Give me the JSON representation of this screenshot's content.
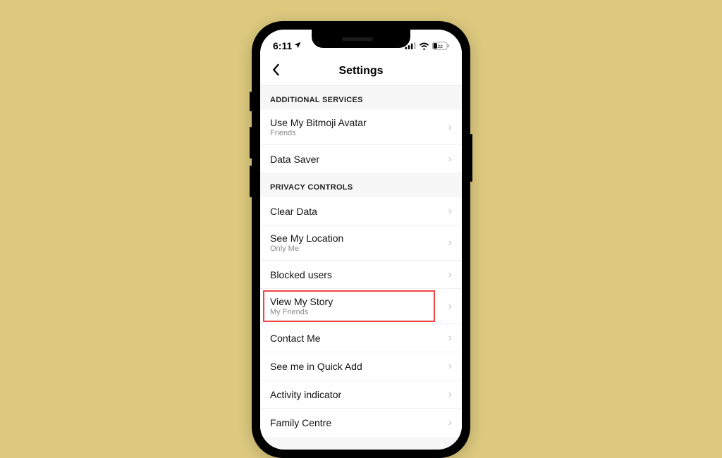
{
  "statusBar": {
    "time": "6:11",
    "batteryText": "22"
  },
  "header": {
    "title": "Settings"
  },
  "sections": [
    {
      "title": "ADDITIONAL SERVICES",
      "items": [
        {
          "label": "Use My Bitmoji Avatar",
          "sub": "Friends"
        },
        {
          "label": "Data Saver",
          "sub": ""
        }
      ]
    },
    {
      "title": "PRIVACY CONTROLS",
      "items": [
        {
          "label": "Clear Data",
          "sub": ""
        },
        {
          "label": "See My Location",
          "sub": "Only Me"
        },
        {
          "label": "Blocked users",
          "sub": ""
        },
        {
          "label": "View My Story",
          "sub": "My Friends",
          "highlighted": true
        },
        {
          "label": "Contact Me",
          "sub": ""
        },
        {
          "label": "See me in Quick Add",
          "sub": ""
        },
        {
          "label": "Activity indicator",
          "sub": ""
        },
        {
          "label": "Family Centre",
          "sub": ""
        }
      ]
    }
  ]
}
